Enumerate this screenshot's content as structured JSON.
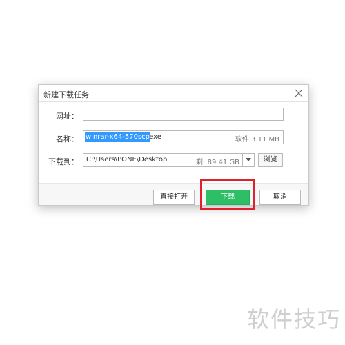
{
  "dialog": {
    "title": "新建下载任务",
    "close_icon": "close-icon"
  },
  "form": {
    "url_label": "网址：",
    "url_value": "",
    "name_label": "名称：",
    "name_selected": "winrar-x64-570scp",
    "name_ext": ".exe",
    "file_size": "软件 3.11 MB",
    "save_label": "下载到：",
    "save_path": "C:\\Users\\PONE\\Desktop",
    "free_space": "剩: 89.41 GB",
    "dropdown_icon": "chevron-down-icon",
    "browse_label": "浏览"
  },
  "buttons": {
    "open_label": "直接打开",
    "download_label": "下载",
    "cancel_label": "取消"
  },
  "colors": {
    "accent_green": "#2ebf66",
    "selection_blue": "#3399ff",
    "highlight_red": "#e0202c"
  },
  "watermark": "软件技巧"
}
